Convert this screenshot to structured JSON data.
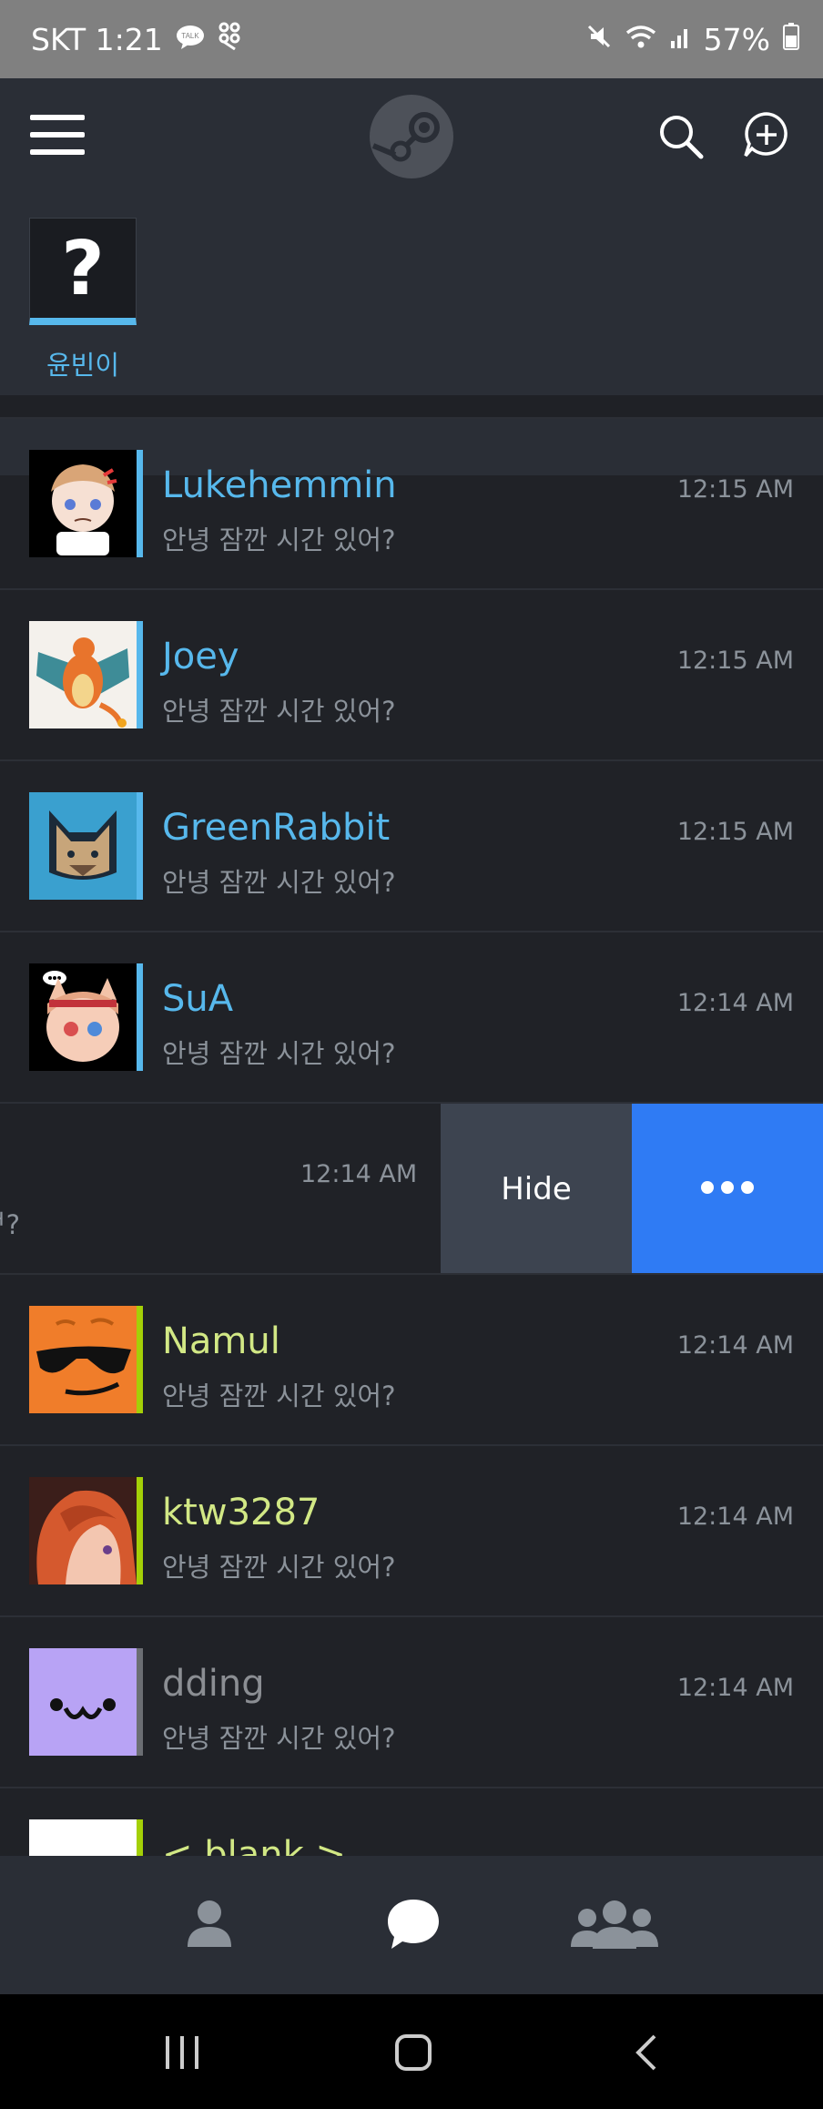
{
  "status_bar": {
    "carrier_time": "SKT 1:21",
    "battery": "57%",
    "icons": [
      "talk-icon",
      "app-icon",
      "mute-icon",
      "wifi-icon",
      "signal-icon",
      "battery-icon"
    ]
  },
  "header": {
    "icons": [
      "menu-icon",
      "steam-logo",
      "search-icon",
      "add-chat-icon"
    ],
    "my_avatar_text": "?",
    "my_name": "윤빈이"
  },
  "chats": [
    {
      "name": "Lukehemmin",
      "message": "안녕 잠깐 시간 있어?",
      "time": "12:15 AM",
      "status": "online"
    },
    {
      "name": "Joey",
      "message": "안녕 잠깐 시간 있어?",
      "time": "12:15 AM",
      "status": "online"
    },
    {
      "name": "GreenRabbit",
      "message": "안녕 잠깐 시간 있어?",
      "time": "12:15 AM",
      "status": "online"
    },
    {
      "name": "SuA",
      "message": "안녕 잠깐 시간 있어?",
      "time": "12:14 AM",
      "status": "online"
    },
    {
      "name": "",
      "message": "ᅥ?",
      "time": "12:14 AM",
      "status": "swiped"
    },
    {
      "name": "Namul",
      "message": "안녕 잠깐 시간 있어?",
      "time": "12:14 AM",
      "status": "in-game"
    },
    {
      "name": "ktw3287",
      "message": "안녕 잠깐 시간 있어?",
      "time": "12:14 AM",
      "status": "in-game"
    },
    {
      "name": "dding",
      "message": "안녕 잠깐 시간 있어?",
      "time": "12:14 AM",
      "status": "offline"
    },
    {
      "name": "< blank >",
      "message": "",
      "time": "",
      "status": "in-game"
    }
  ],
  "swipe_actions": {
    "hide_label": "Hide",
    "more_icon": "more-icon"
  },
  "colors": {
    "online": "#57b8ec",
    "in_game": "#a4d007",
    "in_game_name": "#d2e885",
    "offline": "#6b6e73",
    "offline_name": "#8b8e93",
    "more_button": "#2f7bf4",
    "hide_button": "#3d4450"
  },
  "bottom_nav": [
    "profile-icon",
    "chat-icon",
    "friends-icon"
  ],
  "android_nav": [
    "recents-icon",
    "home-icon",
    "back-icon"
  ]
}
